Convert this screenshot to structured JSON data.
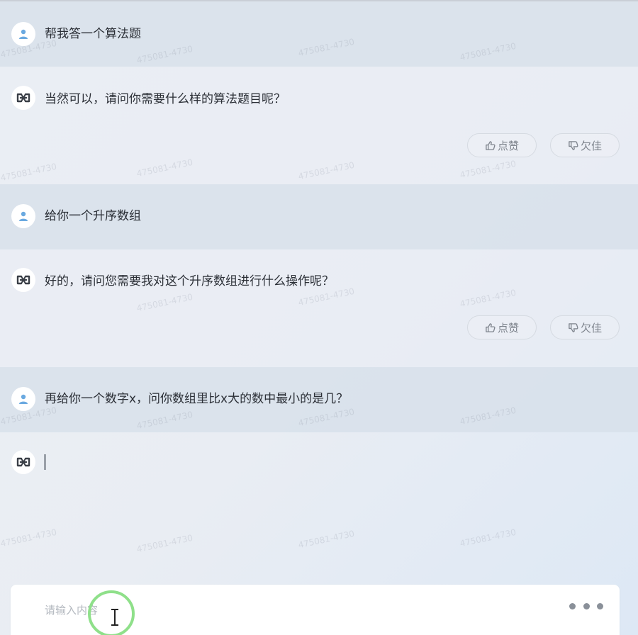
{
  "conversation": [
    {
      "role": "user",
      "text": "帮我答一个算法题"
    },
    {
      "role": "assistant",
      "text": "当然可以，请问你需要什么样的算法题目呢？"
    },
    {
      "role": "user",
      "text": "给你一个升序数组"
    },
    {
      "role": "assistant",
      "text": "好的，请问您需要我对这个升序数组进行什么操作呢？"
    },
    {
      "role": "user",
      "text": "再给你一个数字x，问你数组里比x大的数中最小的是几？"
    }
  ],
  "feedback": {
    "like_label": "点赞",
    "dislike_label": "欠佳"
  },
  "input": {
    "placeholder": "请输入内容"
  },
  "watermark_text": "475081-4730",
  "icons": {
    "user_avatar": "user-icon",
    "assistant_avatar": "assistant-logo-icon",
    "like": "thumbs-up-icon",
    "dislike": "thumbs-down-icon",
    "more": "more-dots-icon"
  },
  "colors": {
    "user_avatar_icon": "#6aa9e0",
    "user_block_bg": "#d6dfe9",
    "assistant_block_bg": "#e9edf4",
    "click_ring": "#8fe08a"
  }
}
